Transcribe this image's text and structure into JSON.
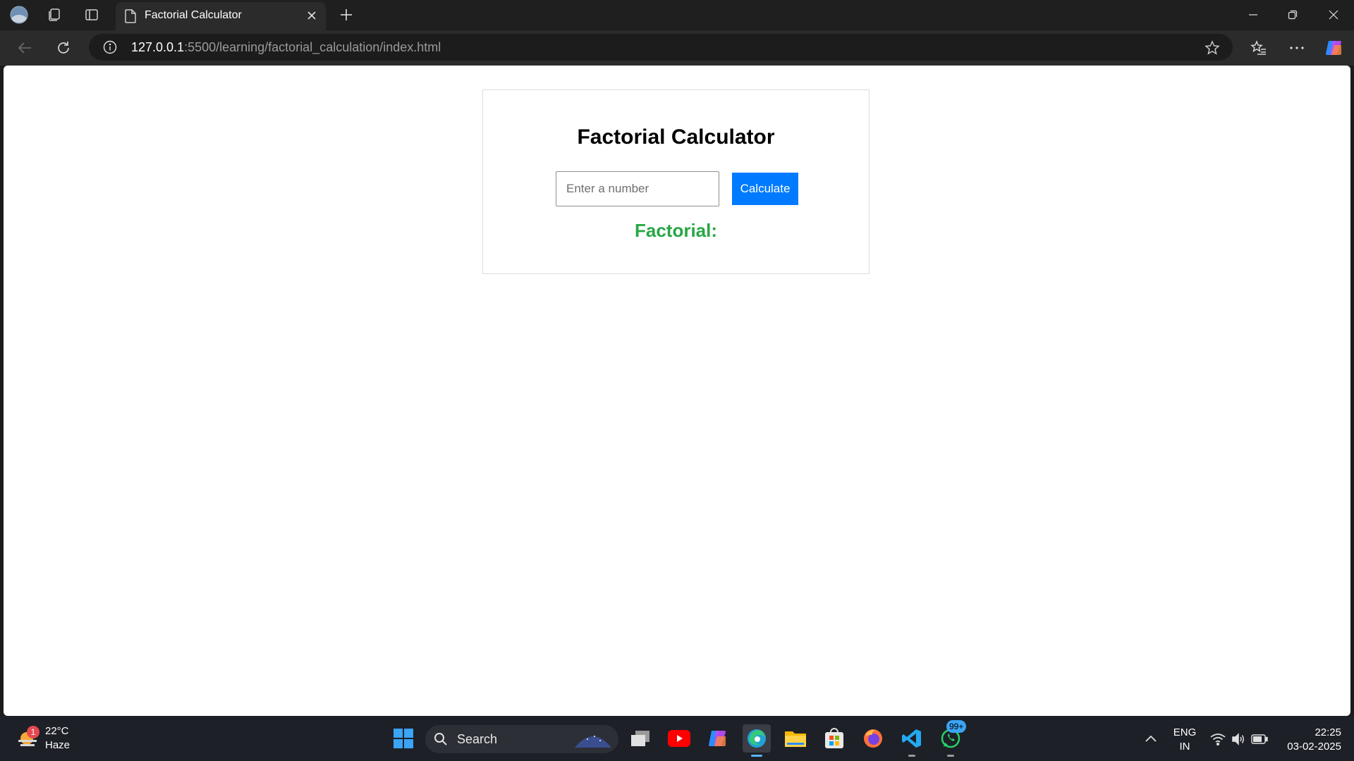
{
  "browser": {
    "tab_title": "Factorial Calculator",
    "address_host": "127.0.0.1",
    "address_path": ":5500/learning/factorial_calculation/index.html"
  },
  "page": {
    "heading": "Factorial Calculator",
    "input_placeholder": "Enter a number",
    "input_value": "",
    "button_label": "Calculate",
    "result_label": "Factorial:",
    "accent_color": "#007bff",
    "result_color": "#28a745"
  },
  "taskbar": {
    "weather_temp": "22°C",
    "weather_desc": "Haze",
    "weather_badge": "1",
    "search_label": "Search",
    "whatsapp_badge": "99+",
    "lang_top": "ENG",
    "lang_bottom": "IN",
    "time": "22:25",
    "date": "03-02-2025"
  }
}
